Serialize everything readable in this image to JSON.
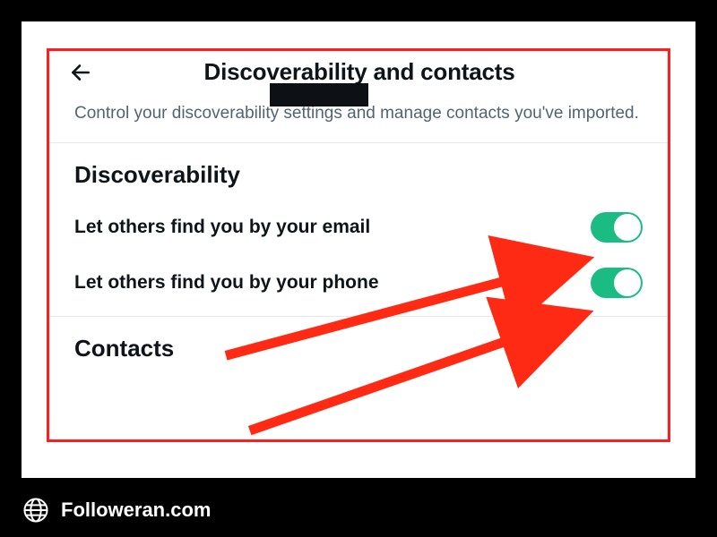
{
  "header": {
    "title": "Discoverability and contacts"
  },
  "description": "Control your discoverability settings and manage contacts you've imported.",
  "section1": {
    "heading": "Discoverability",
    "settings": [
      {
        "label": "Let others find you by your email",
        "enabled": true
      },
      {
        "label": "Let others find you by your phone",
        "enabled": true
      }
    ]
  },
  "section2": {
    "heading": "Contacts"
  },
  "footer": {
    "site": "Followeran.com"
  }
}
